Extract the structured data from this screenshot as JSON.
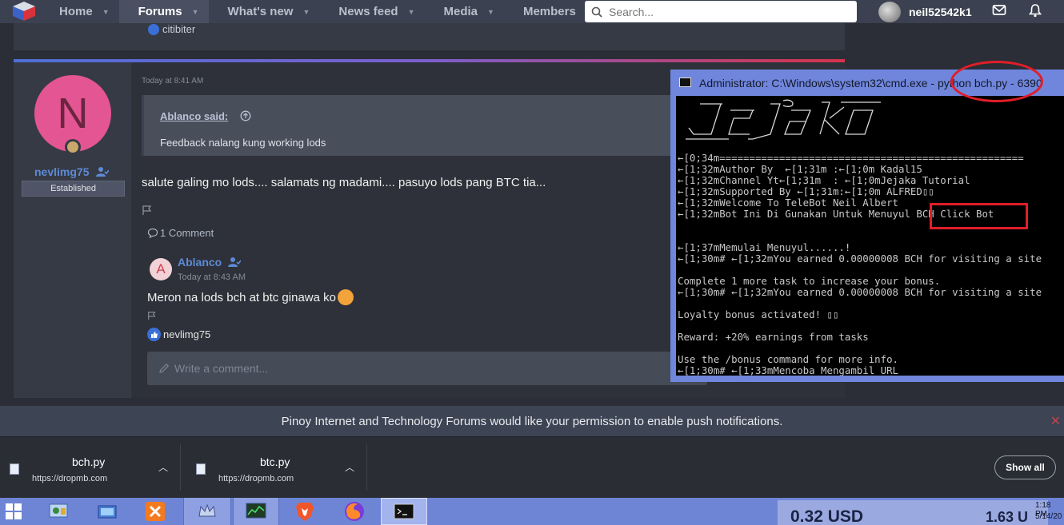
{
  "nav": {
    "items": [
      {
        "label": "Home",
        "active": false
      },
      {
        "label": "Forums",
        "active": true
      },
      {
        "label": "What's new",
        "active": false
      },
      {
        "label": "News feed",
        "active": false
      },
      {
        "label": "Media",
        "active": false
      },
      {
        "label": "Members",
        "active": false
      }
    ],
    "search_placeholder": "Search...",
    "username": "neil52542k1"
  },
  "previous_post": {
    "liker": "citibiter"
  },
  "post": {
    "author": "nevlimg75",
    "avatar_letter": "N",
    "user_title": "Established",
    "time": "Today at 8:41 AM",
    "quote_author": "Ablanco said:",
    "quote_text": "Feedback nalang kung working lods",
    "body": "salute galing mo lods.... salamats ng madami.... pasuyo lods pang BTC tia...",
    "comments_label": "1 Comment",
    "comment": {
      "avatar_letter": "A",
      "author": "Ablanco",
      "time": "Today at 8:43 AM",
      "body": "Meron na lods bch at btc ginawa ko"
    },
    "liker": "nevlimg75",
    "write_comment_placeholder": "Write a comment..."
  },
  "cmd": {
    "title": "Administrator: C:\\Windows\\system32\\cmd.exe - python  bch.py - 6390",
    "lines": [
      "←[0;34m===================================================",
      "←[1;32mAuthor By  ←[1;31m :←[1;0m Kadal15",
      "←[1;32mChannel Yt←[1;31m  : ←[1;0mJejaka Tutorial",
      "←[1;32mSupported By ←[1;31m:←[1;0m ALFRED▯▯",
      "←[1;32mWelcome To TeleBot Neil Albert",
      "←[1;32mBot Ini Di Gunakan Untuk Menuyul BCH Click Bot",
      "",
      "",
      "←[1;37mMemulai Menuyul......!",
      "←[1;30m# ←[1;32mYou earned 0.00000008 BCH for visiting a site",
      "",
      "Complete 1 more task to increase your bonus.",
      "←[1;30m# ←[1;32mYou earned 0.00000008 BCH for visiting a site",
      "",
      "Loyalty bonus activated! ▯▯",
      "",
      "Reward: +20% earnings from tasks",
      "",
      "Use the /bonus command for more info.",
      "←[1;30m# ←[1;33mMencoba Mengambil URL"
    ]
  },
  "push_notice": "Pinoy Internet and Technology Forums would like your permission to enable push notifications.",
  "downloads": {
    "items": [
      {
        "name": "bch.py",
        "url": "https://dropmb.com"
      },
      {
        "name": "btc.py",
        "url": "https://dropmb.com"
      }
    ],
    "show_all": "Show all"
  },
  "taskbar": {
    "usd_value": "0.32 USD",
    "overflow_value": "1.63 U",
    "clock_time": "1:18 PM",
    "clock_date": "5/14/20"
  },
  "colors": {
    "accent": "#5d8ad6",
    "annotation_red": "#e01e28",
    "cmd_frame": "#6f86dc"
  }
}
